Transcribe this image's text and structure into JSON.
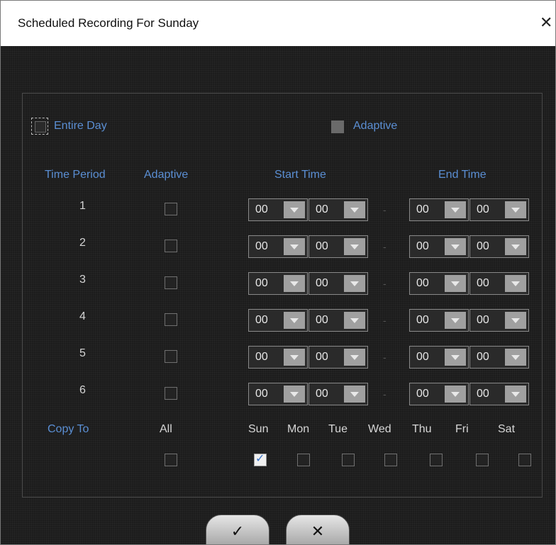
{
  "window": {
    "title": "Scheduled Recording For Sunday",
    "close_glyph": "✕"
  },
  "top": {
    "entire_day_label": "Entire Day",
    "adaptive_label": "Adaptive",
    "entire_day_checked": false,
    "adaptive_checked": false
  },
  "headers": {
    "time_period": "Time Period",
    "adaptive": "Adaptive",
    "start_time": "Start Time",
    "end_time": "End Time"
  },
  "periods": [
    {
      "label": "1",
      "adaptive": false,
      "start_hour": "00",
      "start_min": "00",
      "separator": "-",
      "end_hour": "00",
      "end_min": "00"
    },
    {
      "label": "2",
      "adaptive": false,
      "start_hour": "00",
      "start_min": "00",
      "separator": "-",
      "end_hour": "00",
      "end_min": "00"
    },
    {
      "label": "3",
      "adaptive": false,
      "start_hour": "00",
      "start_min": "00",
      "separator": "-",
      "end_hour": "00",
      "end_min": "00"
    },
    {
      "label": "4",
      "adaptive": false,
      "start_hour": "00",
      "start_min": "00",
      "separator": "-",
      "end_hour": "00",
      "end_min": "00"
    },
    {
      "label": "5",
      "adaptive": false,
      "start_hour": "00",
      "start_min": "00",
      "separator": "-",
      "end_hour": "00",
      "end_min": "00"
    },
    {
      "label": "6",
      "adaptive": false,
      "start_hour": "00",
      "start_min": "00",
      "separator": "-",
      "end_hour": "00",
      "end_min": "00"
    }
  ],
  "copy_to": {
    "label": "Copy To",
    "all_label": "All",
    "all_checked": false,
    "days": [
      {
        "label": "Sun",
        "checked": true
      },
      {
        "label": "Mon",
        "checked": false
      },
      {
        "label": "Tue",
        "checked": false
      },
      {
        "label": "Wed",
        "checked": false
      },
      {
        "label": "Thu",
        "checked": false
      },
      {
        "label": "Fri",
        "checked": false
      },
      {
        "label": "Sat",
        "checked": false
      }
    ]
  },
  "buttons": {
    "ok_glyph": "✓",
    "cancel_glyph": "✕"
  },
  "icons": {
    "ok": "check-icon",
    "cancel": "close-icon",
    "dropdown": "chevron-down-icon"
  },
  "colors": {
    "label_blue": "#5b8fd4",
    "dialog_bg": "#1c1c1c",
    "checkbox_tick": "#3a74c8"
  }
}
